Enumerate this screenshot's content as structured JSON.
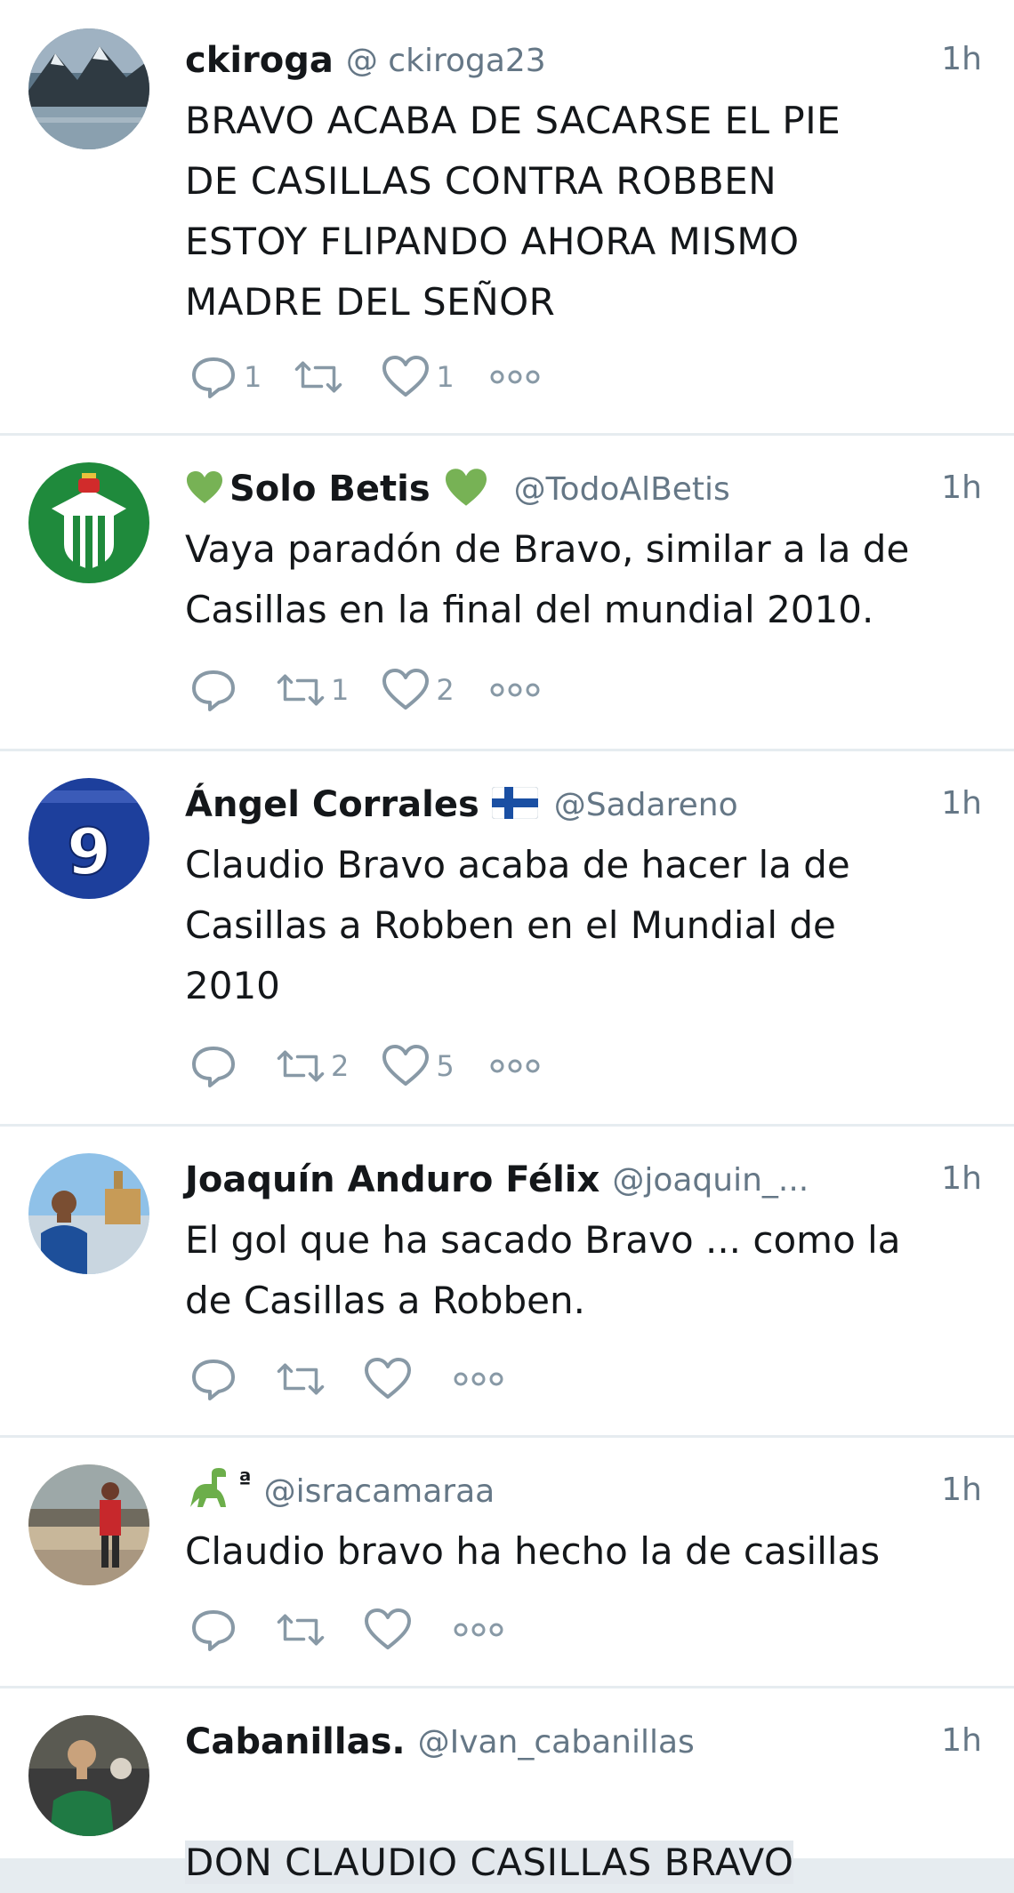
{
  "tweets": [
    {
      "name": "ckiroga",
      "handle": "@ ckiroga23",
      "time": "1h",
      "text": "BRAVO ACABA DE SACARSE EL PIE\nDE CASILLAS CONTRA ROBBEN\nESTOY FLIPANDO AHORA MISMO\nMADRE DEL SEÑOR",
      "replies": "1",
      "retweets": "",
      "likes": "1",
      "avatar": "mountain-lake-photo"
    },
    {
      "name": "Solo Betis",
      "handle": "@TodoAlBetis",
      "time": "1h",
      "text": "Vaya paradón de Bravo, similar a la de\nCasillas en la final del mundial 2010.",
      "replies": "",
      "retweets": "1",
      "likes": "2",
      "avatar": "real-betis-crest",
      "name_prefix_icon": "green-heart-emoji",
      "name_suffix_icon": "green-heart-emoji"
    },
    {
      "name": "Ángel Corrales",
      "handle": "@Sadareno",
      "time": "1h",
      "text": "Claudio Bravo acaba de hacer la de\nCasillas a Robben en el Mundial de\n2010",
      "replies": "",
      "retweets": "2",
      "likes": "5",
      "avatar": "blue-jersey-number-9",
      "avatar_text": "9",
      "name_suffix_icon": "finland-flag-emoji"
    },
    {
      "name": "Joaquín Anduro Félix",
      "handle": "@joaquin_...",
      "time": "1h",
      "text": "El gol que ha sacado Bravo ... como la\nde Casillas a Robben.",
      "replies": "",
      "retweets": "",
      "likes": "",
      "avatar": "person-in-city-photo"
    },
    {
      "name": "ª",
      "handle": "@isracamaraa",
      "time": "1h",
      "text": "Claudio bravo ha hecho la de casillas",
      "replies": "",
      "retweets": "",
      "likes": "",
      "avatar": "person-red-shirt-photo",
      "name_prefix_icon": "dinosaur-emoji"
    },
    {
      "name": "Cabanillas.",
      "handle": "@Ivan_cabanillas",
      "time": "1h",
      "text": "DON CLAUDIO CASILLAS BRAVO",
      "replies": "",
      "retweets": "",
      "likes": "",
      "avatar": "person-green-shirt-photo"
    }
  ],
  "colors": {
    "text": "#14171a",
    "secondary": "#657786",
    "icon": "#8899a6",
    "heart_emoji": "#77b255",
    "divider": "#e6ecf0"
  },
  "icons": {
    "reply": "reply-icon",
    "retweet": "retweet-icon",
    "like": "heart-icon",
    "more": "more-icon"
  }
}
